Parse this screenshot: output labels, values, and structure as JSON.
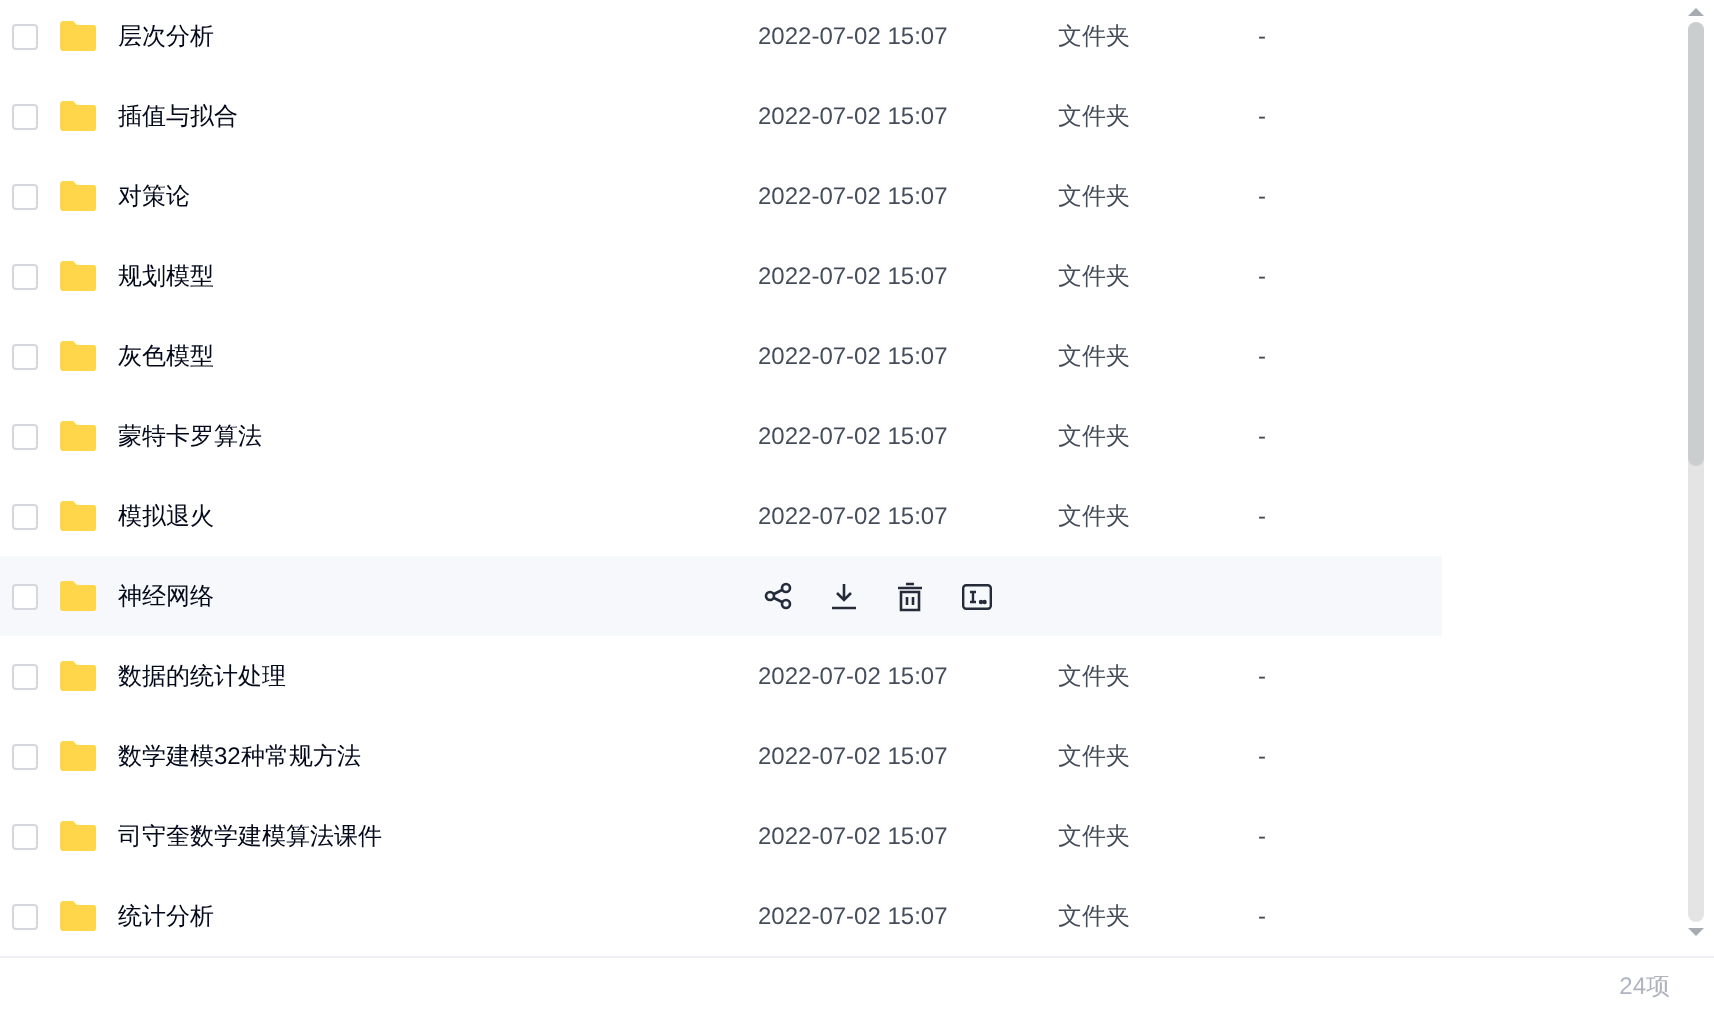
{
  "rows": [
    {
      "name": "层次分析",
      "date": "2022-07-02 15:07",
      "type": "文件夹",
      "size": "-",
      "checked": false,
      "hovered": false
    },
    {
      "name": "插值与拟合",
      "date": "2022-07-02 15:07",
      "type": "文件夹",
      "size": "-",
      "checked": false,
      "hovered": false
    },
    {
      "name": "对策论",
      "date": "2022-07-02 15:07",
      "type": "文件夹",
      "size": "-",
      "checked": false,
      "hovered": false
    },
    {
      "name": "规划模型",
      "date": "2022-07-02 15:07",
      "type": "文件夹",
      "size": "-",
      "checked": false,
      "hovered": false
    },
    {
      "name": "灰色模型",
      "date": "2022-07-02 15:07",
      "type": "文件夹",
      "size": "-",
      "checked": false,
      "hovered": false
    },
    {
      "name": "蒙特卡罗算法",
      "date": "2022-07-02 15:07",
      "type": "文件夹",
      "size": "-",
      "checked": false,
      "hovered": false
    },
    {
      "name": "模拟退火",
      "date": "2022-07-02 15:07",
      "type": "文件夹",
      "size": "-",
      "checked": false,
      "hovered": false
    },
    {
      "name": "神经网络",
      "checked": false,
      "hovered": true
    },
    {
      "name": "数据的统计处理",
      "date": "2022-07-02 15:07",
      "type": "文件夹",
      "size": "-",
      "checked": false,
      "hovered": false
    },
    {
      "name": "数学建模32种常规方法",
      "date": "2022-07-02 15:07",
      "type": "文件夹",
      "size": "-",
      "checked": false,
      "hovered": false
    },
    {
      "name": "司守奎数学建模算法课件",
      "date": "2022-07-02 15:07",
      "type": "文件夹",
      "size": "-",
      "checked": false,
      "hovered": false
    },
    {
      "name": "统计分析",
      "date": "2022-07-02 15:07",
      "type": "文件夹",
      "size": "-",
      "checked": false,
      "hovered": false
    }
  ],
  "footer": {
    "count": "24项"
  }
}
